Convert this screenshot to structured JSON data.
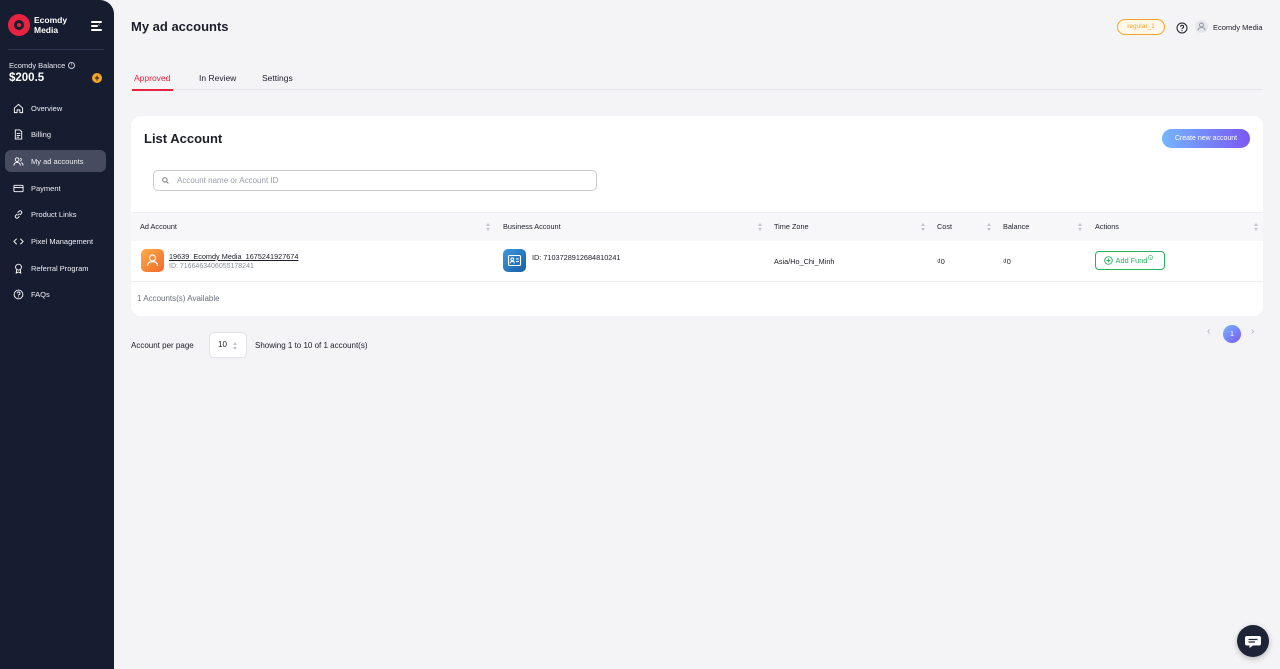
{
  "brand": {
    "name": "Ecomdy Media"
  },
  "sidebar": {
    "balance_label": "Ecomdy Balance",
    "balance_value": "$200.5",
    "add_symbol": "+",
    "items": [
      {
        "label": "Overview",
        "icon": "home-icon"
      },
      {
        "label": "Billing",
        "icon": "document-icon"
      },
      {
        "label": "My ad accounts",
        "icon": "users-icon",
        "active": true
      },
      {
        "label": "Payment",
        "icon": "credit-card-icon"
      },
      {
        "label": "Product Links",
        "icon": "link-icon"
      },
      {
        "label": "Pixel Management",
        "icon": "code-icon"
      },
      {
        "label": "Referral Program",
        "icon": "award-icon"
      },
      {
        "label": "FAQs",
        "icon": "help-circle-icon"
      }
    ]
  },
  "header": {
    "title": "My ad accounts",
    "user_tag": "regular_1",
    "user_name": "Ecomdy Media"
  },
  "tabs": [
    {
      "label": "Approved",
      "active": true
    },
    {
      "label": "In Review"
    },
    {
      "label": "Settings"
    }
  ],
  "list": {
    "title": "List Account",
    "create_button": "Create new account",
    "search": {
      "placeholder": "Account name or Account ID",
      "value": ""
    },
    "columns": [
      "Ad Account",
      "Business Account",
      "Time Zone",
      "Cost",
      "Balance",
      "Actions"
    ],
    "rows": [
      {
        "ad_account_name": "19639_Ecomdy Media_1675241927674",
        "ad_account_id": "ID: 7166463406055178241",
        "business_account_id": "ID: 7103728912684810241",
        "time_zone": "Asia/Ho_Chi_Minh",
        "cost": "₫0",
        "balance": "₫0",
        "action_label": "Add Fund"
      }
    ],
    "available": "1 Accounts(s) Available"
  },
  "pagination": {
    "per_page_label": "Account per page",
    "per_page_value": "10",
    "showing": "Showing 1 to 10 of 1 account(s)",
    "prev": "‹",
    "current": "1",
    "next": "›"
  },
  "colors": {
    "sidebar_bg": "#171d30",
    "accent": "#e8233f",
    "tag": "#f5a524",
    "success": "#27ae60",
    "gradient_start": "#74b5ff",
    "gradient_end": "#7a58f3"
  }
}
